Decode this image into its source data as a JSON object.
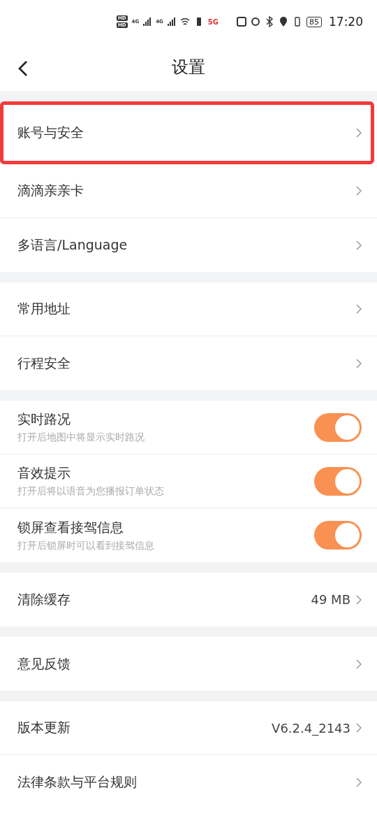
{
  "status_bar": {
    "sim_badges": [
      "HD",
      "HD"
    ],
    "networks": [
      "4G",
      "4G"
    ],
    "data": "5G",
    "battery": "85",
    "time": "17:20"
  },
  "header": {
    "title": "设置"
  },
  "groups": [
    {
      "items": [
        {
          "kind": "link",
          "label": "账号与安全",
          "highlighted": true
        },
        {
          "kind": "link",
          "label": "滴滴亲亲卡",
          "highlighted": false
        },
        {
          "kind": "link",
          "label": "多语言/Language",
          "highlighted": false
        }
      ]
    },
    {
      "items": [
        {
          "kind": "link",
          "label": "常用地址",
          "highlighted": false
        },
        {
          "kind": "link",
          "label": "行程安全",
          "highlighted": false
        }
      ]
    },
    {
      "items": [
        {
          "kind": "toggle",
          "label": "实时路况",
          "hint": "打开后地图中将显示实时路况",
          "on": true
        },
        {
          "kind": "toggle",
          "label": "音效提示",
          "hint": "打开后将以语音为您播报订单状态",
          "on": true
        },
        {
          "kind": "toggle",
          "label": "锁屏查看接驾信息",
          "hint": "打开后锁屏时可以看到接驾信息",
          "on": true
        }
      ]
    },
    {
      "items": [
        {
          "kind": "link",
          "label": "清除缓存",
          "value": "49 MB",
          "highlighted": false
        }
      ]
    },
    {
      "items": [
        {
          "kind": "link",
          "label": "意见反馈",
          "highlighted": false
        }
      ]
    },
    {
      "items": [
        {
          "kind": "link",
          "label": "版本更新",
          "value": "V6.2.4_2143",
          "highlighted": false
        },
        {
          "kind": "link",
          "label": "法律条款与平台规则",
          "highlighted": false
        }
      ]
    }
  ]
}
